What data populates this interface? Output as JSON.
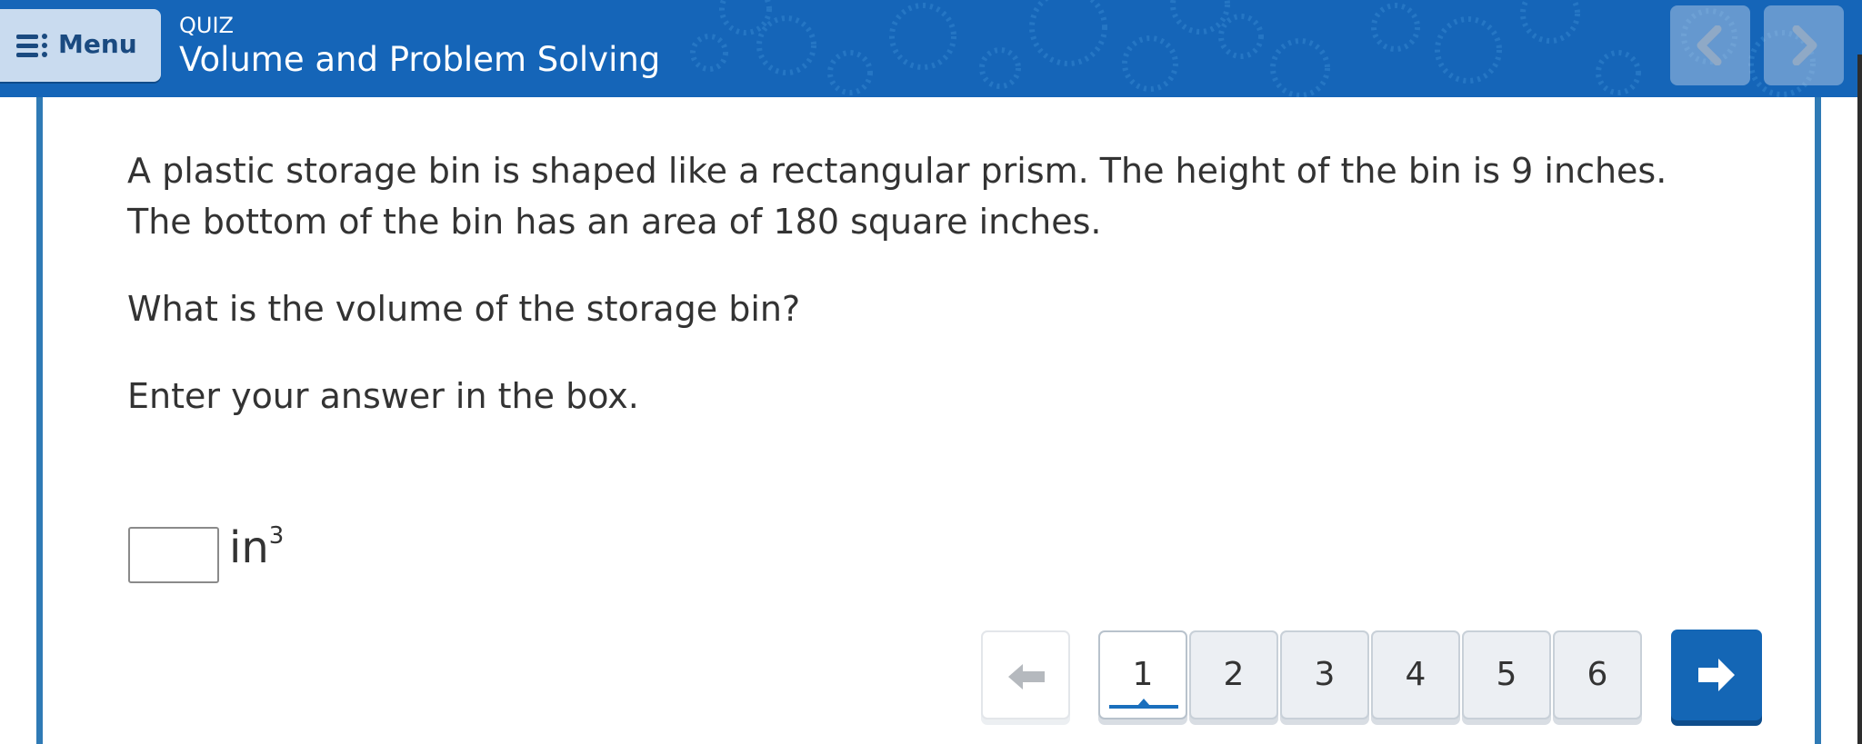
{
  "header": {
    "menu_label": "Menu",
    "quiz_tag": "QUIZ",
    "title": "Volume and Problem Solving",
    "bg_color": "#1565b8"
  },
  "question": {
    "paragraph1_line1": "A plastic storage bin is shaped like a rectangular prism. The height of the bin is 9 inches.",
    "paragraph1_line2": "The bottom of the bin has an area of 180 square inches.",
    "prompt": "What is the volume of the storage bin?",
    "instruction": "Enter your answer in the box.",
    "answer_value": "",
    "unit_base": "in",
    "unit_exp": "3"
  },
  "pager": {
    "pages": [
      "1",
      "2",
      "3",
      "4",
      "5",
      "6"
    ],
    "current": "1",
    "accent": "#1466b5"
  },
  "icons": {
    "menu": "hamburger-icon",
    "header_prev": "chevron-left-icon",
    "header_next": "chevron-right-icon",
    "pager_prev": "arrow-left-icon",
    "pager_next": "arrow-right-icon"
  }
}
